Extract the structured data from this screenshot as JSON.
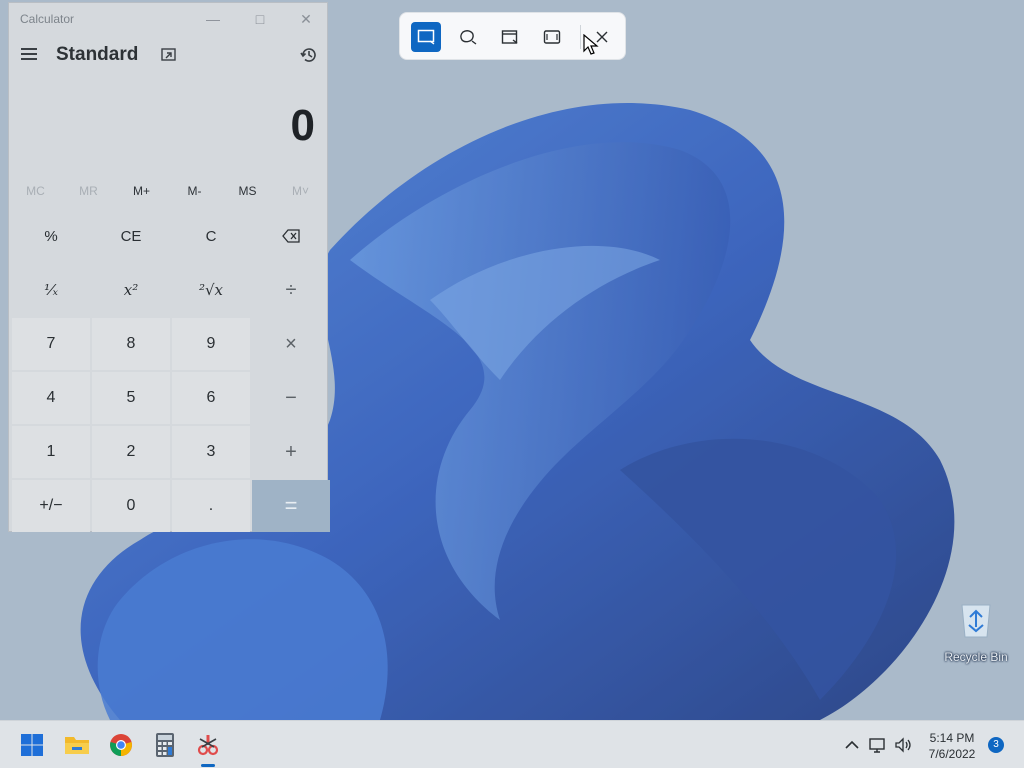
{
  "calculator": {
    "window_title": "Calculator",
    "mode": "Standard",
    "display": "0",
    "memory": [
      "MC",
      "MR",
      "M+",
      "M-",
      "MS",
      "M˅"
    ],
    "keys": [
      "%",
      "CE",
      "C",
      "⌫",
      "¹⁄ₓ",
      "x²",
      "²√x",
      "÷",
      "7",
      "8",
      "9",
      "×",
      "4",
      "5",
      "6",
      "−",
      "1",
      "2",
      "3",
      "+",
      "+/−",
      "0",
      ".",
      "="
    ]
  },
  "snip_toolbar": {
    "modes": [
      "rectangular-snip",
      "freeform-snip",
      "window-snip",
      "fullscreen-snip"
    ],
    "active_mode": "rectangular-snip",
    "close_label": "Close"
  },
  "desktop": {
    "recycle_bin_label": "Recycle Bin"
  },
  "taskbar": {
    "apps": [
      "Start",
      "File Explorer",
      "Google Chrome",
      "Calculator",
      "Snipping Tool"
    ],
    "time": "5:14 PM",
    "date": "7/6/2022",
    "notification_count": "3"
  },
  "colors": {
    "accent": "#0f67c2",
    "wallpaper_blue": "#1b4fc4"
  }
}
